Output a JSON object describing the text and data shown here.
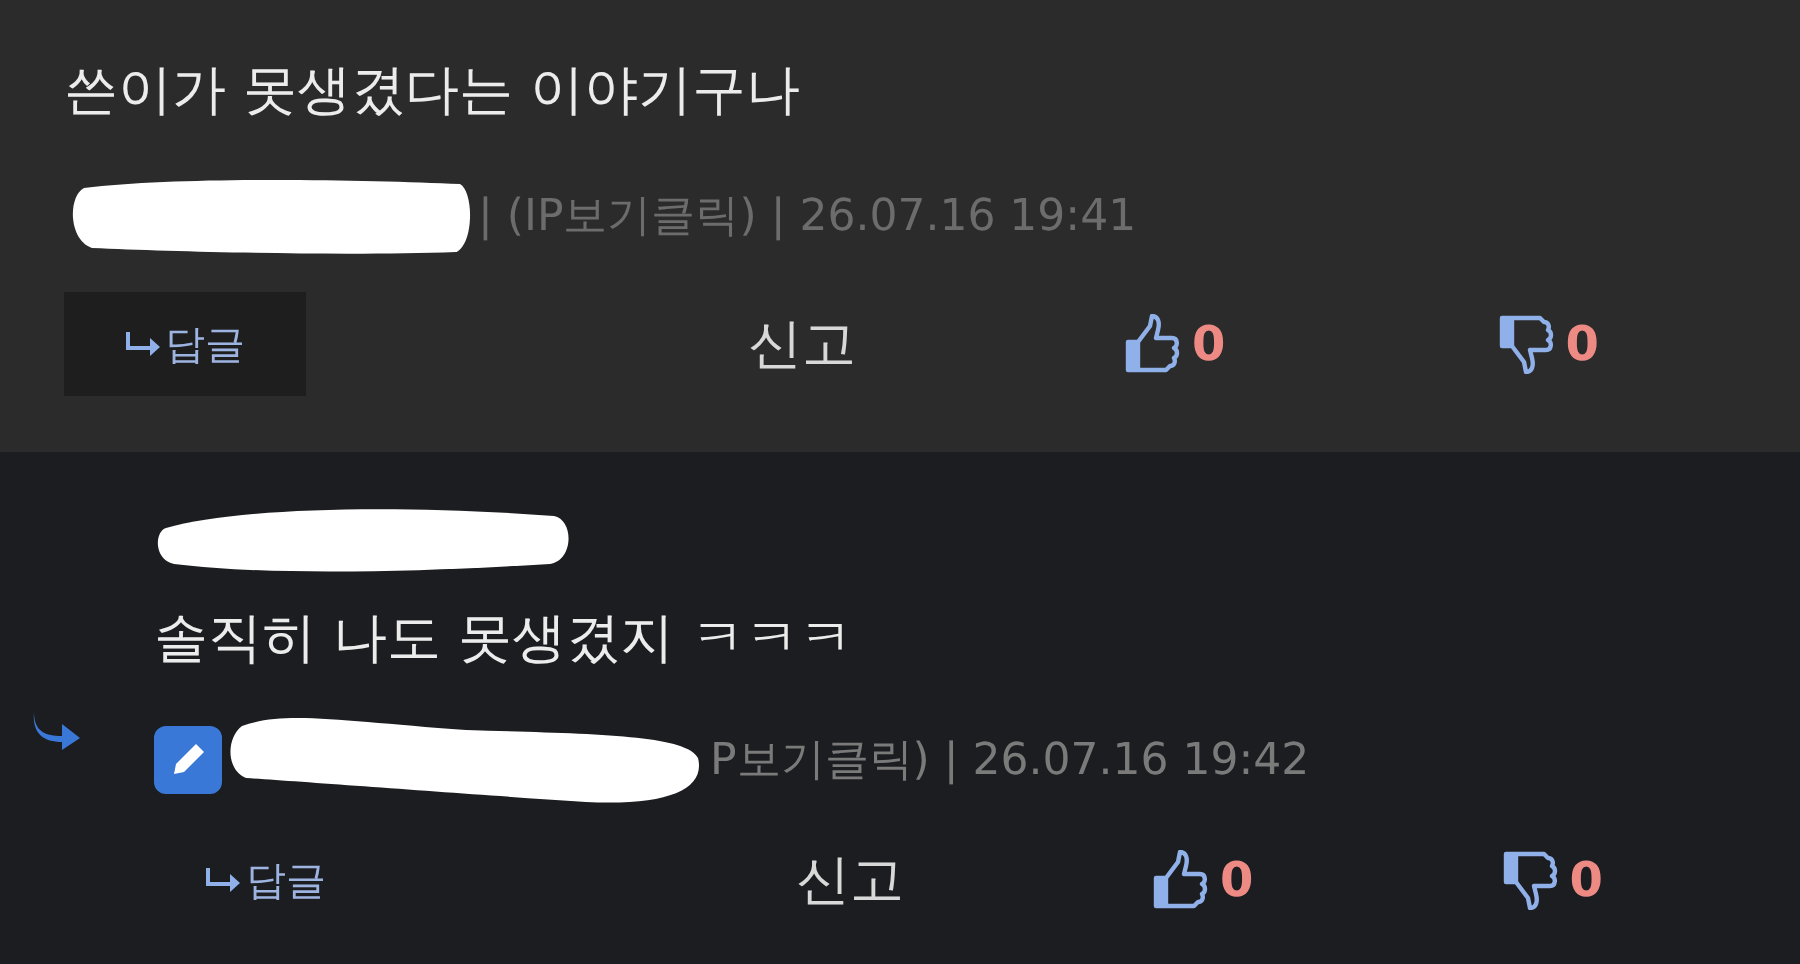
{
  "comments": [
    {
      "is_reply": false,
      "editor_badge": false,
      "text": "쓴이가 못생겼다는 이야기구나",
      "meta": "| (IP보기클릭) | 26.07.16 19:41",
      "reply_label": "답글",
      "report_label": "신고",
      "likes": "0",
      "dislikes": "0"
    },
    {
      "is_reply": true,
      "editor_badge": true,
      "text": "솔직히 나도 못생겼지 ㅋㅋㅋ",
      "meta": "P보기클릭) | 26.07.16 19:42",
      "reply_label": "답글",
      "report_label": "신고",
      "likes": "0",
      "dislikes": "0"
    }
  ]
}
